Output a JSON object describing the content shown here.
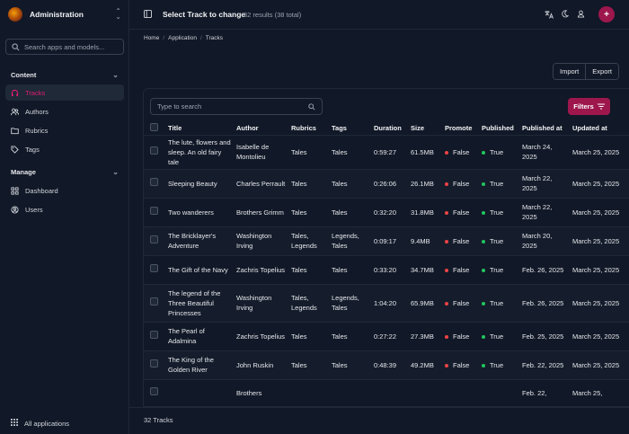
{
  "app": {
    "name": "Administration"
  },
  "sidebar": {
    "search_placeholder": "Search apps and models...",
    "sections": [
      {
        "title": "Content",
        "items": [
          {
            "label": "Tracks",
            "icon": "headphones-icon",
            "active": true
          },
          {
            "label": "Authors",
            "icon": "users-icon"
          },
          {
            "label": "Rubrics",
            "icon": "folder-icon"
          },
          {
            "label": "Tags",
            "icon": "tag-icon"
          }
        ]
      },
      {
        "title": "Manage",
        "items": [
          {
            "label": "Dashboard",
            "icon": "dashboard-icon"
          },
          {
            "label": "Users",
            "icon": "user-circle-icon"
          }
        ]
      }
    ],
    "all_apps_label": "All applications"
  },
  "header": {
    "title": "Select Track to change",
    "count": "32 results (38 total)"
  },
  "breadcrumb": [
    "Home",
    "Application",
    "Tracks"
  ],
  "actions": {
    "import": "Import",
    "export": "Export"
  },
  "search": {
    "placeholder": "Type to search"
  },
  "filters_label": "Filters",
  "table": {
    "columns": [
      "Title",
      "Author",
      "Rubrics",
      "Tags",
      "Duration",
      "Size",
      "Promote",
      "Published",
      "Published at",
      "Updated at"
    ],
    "rows": [
      {
        "title": "The lute, flowers and sleep. An old fairy tale",
        "author": "Isabelle de Montolieu",
        "rubrics": "Tales",
        "tags": "Tales",
        "duration": "0:59:27",
        "size": "61.5MB",
        "promote": "False",
        "published": "True",
        "published_at": "March 24, 2025",
        "updated_at": "March 25, 2025"
      },
      {
        "title": "Sleeping Beauty",
        "author": "Charles Perrault",
        "rubrics": "Tales",
        "tags": "Tales",
        "duration": "0:26:06",
        "size": "26.1MB",
        "promote": "False",
        "published": "True",
        "published_at": "March 22, 2025",
        "updated_at": "March 25, 2025"
      },
      {
        "title": "Two wanderers",
        "author": "Brothers Grimm",
        "rubrics": "Tales",
        "tags": "Tales",
        "duration": "0:32:20",
        "size": "31.8MB",
        "promote": "False",
        "published": "True",
        "published_at": "March 22, 2025",
        "updated_at": "March 25, 2025"
      },
      {
        "title": "The Bricklayer's Adventure",
        "author": "Washington Irving",
        "rubrics": "Tales, Legends",
        "tags": "Legends, Tales",
        "duration": "0:09:17",
        "size": "9.4MB",
        "promote": "False",
        "published": "True",
        "published_at": "March 20, 2025",
        "updated_at": "March 25, 2025"
      },
      {
        "title": "The Gift of the Navy",
        "author": "Zachris Topelius",
        "rubrics": "Tales",
        "tags": "Tales",
        "duration": "0:33:20",
        "size": "34.7MB",
        "promote": "False",
        "published": "True",
        "published_at": "Feb. 26, 2025",
        "updated_at": "March 25, 2025"
      },
      {
        "title": "The legend of the Three Beautiful Princesses",
        "author": "Washington Irving",
        "rubrics": "Tales, Legends",
        "tags": "Legends, Tales",
        "duration": "1:04:20",
        "size": "65.9MB",
        "promote": "False",
        "published": "True",
        "published_at": "Feb. 26, 2025",
        "updated_at": "March 25, 2025"
      },
      {
        "title": "The Pearl of Adalmina",
        "author": "Zachris Topelius",
        "rubrics": "Tales",
        "tags": "Tales",
        "duration": "0:27:22",
        "size": "27.3MB",
        "promote": "False",
        "published": "True",
        "published_at": "Feb. 25, 2025",
        "updated_at": "March 25, 2025"
      },
      {
        "title": "The King of the Golden River",
        "author": "John Ruskin",
        "rubrics": "Tales",
        "tags": "Tales",
        "duration": "0:48:39",
        "size": "49.2MB",
        "promote": "False",
        "published": "True",
        "published_at": "Feb. 22, 2025",
        "updated_at": "March 25, 2025"
      },
      {
        "title": "",
        "author": "Brothers",
        "rubrics": "",
        "tags": "",
        "duration": "",
        "size": "",
        "promote": "",
        "published": "",
        "published_at": "Feb. 22,",
        "updated_at": "March 25,"
      }
    ]
  },
  "footer": {
    "count": "32 Tracks"
  },
  "colors": {
    "accent": "#9d174d",
    "active_text": "#e11d72",
    "background": "#111827"
  }
}
